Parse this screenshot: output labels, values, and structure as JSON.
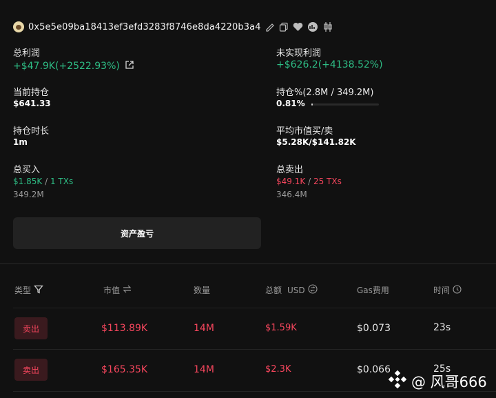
{
  "header": {
    "address": "0x5e5e09ba18413ef3efd3283f8746e8da4220b3a4"
  },
  "stats": {
    "total_profit_label": "总利润",
    "total_profit_value": "+$47.9K(+2522.93%)",
    "unrealized_label": "未实现利润",
    "unrealized_value": "+$626.2(+4138.52%)",
    "holding_label": "当前持仓",
    "holding_value": "$641.33",
    "holding_pct_label": "持仓%(2.8M / 349.2M)",
    "holding_pct_value": "0.81%",
    "holding_pct_fraction": 0.0081,
    "duration_label": "持仓时长",
    "duration_value": "1m",
    "avg_mc_label": "平均市值买/卖",
    "avg_mc_value": "$5.28K/$141.82K",
    "buy_label": "总买入",
    "buy_amount": "$1.85K",
    "buy_sep": "/",
    "buy_txs": "1 TXs",
    "buy_qty": "349.2M",
    "sell_label": "总卖出",
    "sell_amount": "$49.1K",
    "sell_sep": "/",
    "sell_txs": "25 TXs",
    "sell_qty": "346.4M"
  },
  "asset_pnl_button": "资产盈亏",
  "table": {
    "headers": {
      "type": "类型",
      "mc": "市值",
      "qty": "数量",
      "total": "总额",
      "usd": "USD",
      "gas": "Gas费用",
      "time": "时间"
    },
    "rows": [
      {
        "type": "卖出",
        "mc": "$113.89K",
        "qty": "14M",
        "total": "$1.59K",
        "gas": "$0.073",
        "time": "23s"
      },
      {
        "type": "卖出",
        "mc": "$165.35K",
        "qty": "14M",
        "total": "$2.3K",
        "gas": "$0.066",
        "time": "25s"
      }
    ]
  },
  "watermark": "@ 风哥666",
  "colors": {
    "green": "#2ebd85",
    "red": "#f6465d",
    "bg": "#111111"
  }
}
